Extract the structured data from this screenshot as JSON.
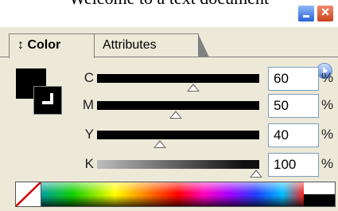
{
  "window": {
    "truncated_title": "Welcome to a text document"
  },
  "tabs": [
    {
      "label": "↕ Color",
      "active": true
    },
    {
      "label": "Attributes",
      "active": false
    }
  ],
  "channels": [
    {
      "label": "C",
      "value": "60",
      "unit": "%",
      "level": 60
    },
    {
      "label": "M",
      "value": "50",
      "unit": "%",
      "level": 50
    },
    {
      "label": "Y",
      "value": "40",
      "unit": "%",
      "level": 40
    },
    {
      "label": "K",
      "value": "100",
      "unit": "%",
      "level": 100
    }
  ],
  "icons": {
    "minimize": "minimize-icon",
    "close": "close-icon",
    "panel_menu": "panel-menu-arrow-icon",
    "none_swatch": "none-swatch-icon"
  },
  "colors": {
    "fill": "#000000",
    "stroke": "#000000"
  }
}
